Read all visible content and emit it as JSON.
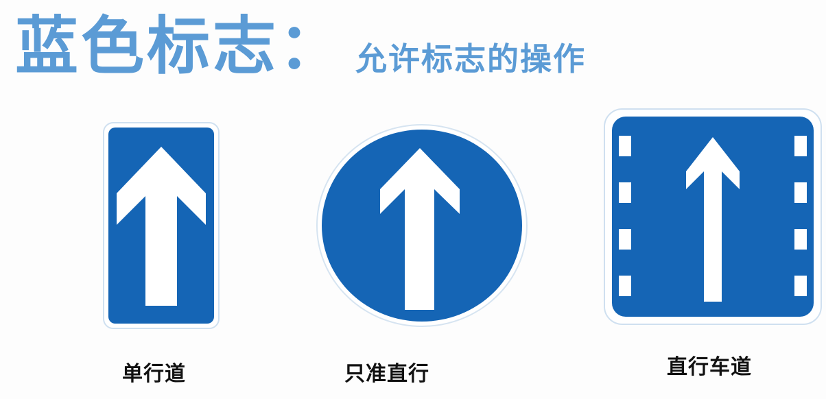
{
  "title": {
    "main": "蓝色标志：",
    "sub": "允许标志的操作"
  },
  "signs": [
    {
      "caption": "单行道",
      "icon": "one-way-arrow-icon"
    },
    {
      "caption": "只准直行",
      "icon": "straight-only-arrow-icon"
    },
    {
      "caption": "直行车道",
      "icon": "straight-lane-arrow-icon"
    }
  ],
  "colors": {
    "title": "#5b9bd5",
    "sign_blue": "#1565b5",
    "sign_white": "#ffffff",
    "caption": "#111111"
  }
}
